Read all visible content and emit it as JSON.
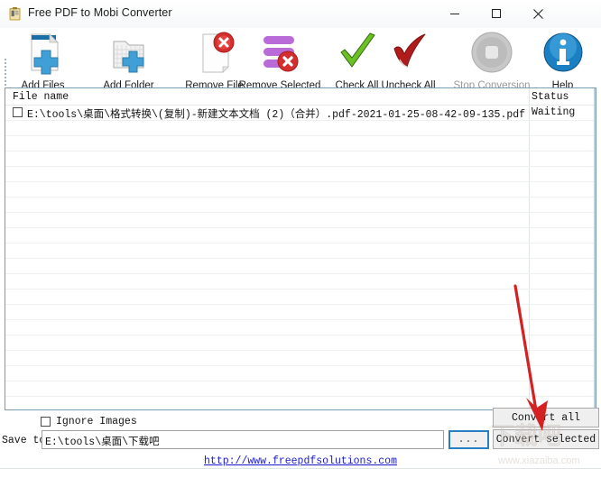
{
  "window": {
    "title": "Free PDF to Mobi Converter",
    "icon": "clipboard-icon",
    "minimize_label": "—",
    "maximize_label": "□",
    "close_label": "✕"
  },
  "toolbar": {
    "items": [
      {
        "label": "Add Files",
        "icon": "add-file-icon",
        "enabled": true
      },
      {
        "label": "Add Folder",
        "icon": "add-folder-icon",
        "enabled": true
      },
      {
        "label": "Remove File",
        "icon": "remove-file-icon",
        "enabled": true
      },
      {
        "label": "Remove Selected",
        "icon": "remove-selected-icon",
        "enabled": true
      },
      {
        "label": "Check All",
        "icon": "check-all-icon",
        "enabled": true
      },
      {
        "label": "Uncheck All",
        "icon": "uncheck-all-icon",
        "enabled": true
      },
      {
        "label": "Stop Conversion",
        "icon": "stop-icon",
        "enabled": false
      },
      {
        "label": "Help",
        "icon": "info-icon",
        "enabled": true
      }
    ]
  },
  "file_list": {
    "columns": [
      "File name",
      "Status"
    ],
    "rows": [
      {
        "checked": false,
        "file_name": "E:\\tools\\桌面\\格式转换\\(复制)-新建文本文档 (2)（合并）.pdf-2021-01-25-08-42-09-135.pdf",
        "status": "Waiting"
      }
    ],
    "empty_row_count": 19
  },
  "options": {
    "ignore_images_label": "Ignore Images",
    "ignore_images_checked": false
  },
  "save_to": {
    "label": "Save to",
    "value": "E:\\tools\\桌面\\下载吧",
    "placeholder": "",
    "browse_label": "..."
  },
  "actions": {
    "convert_all": "Convert all",
    "convert_selected": "Convert selected"
  },
  "footer": {
    "url": "http://www.freepdfsolutions.com"
  },
  "watermark": {
    "text": "下载吧",
    "site": "www.xiazaiba.com"
  },
  "annotation": {
    "arrow_color": "#d42121",
    "points_to": "convert-all-button"
  },
  "colors": {
    "accent": "#2a7fc4",
    "list_border": "#7a9db3",
    "link": "#1a1ad0",
    "arrow": "#d42121"
  }
}
